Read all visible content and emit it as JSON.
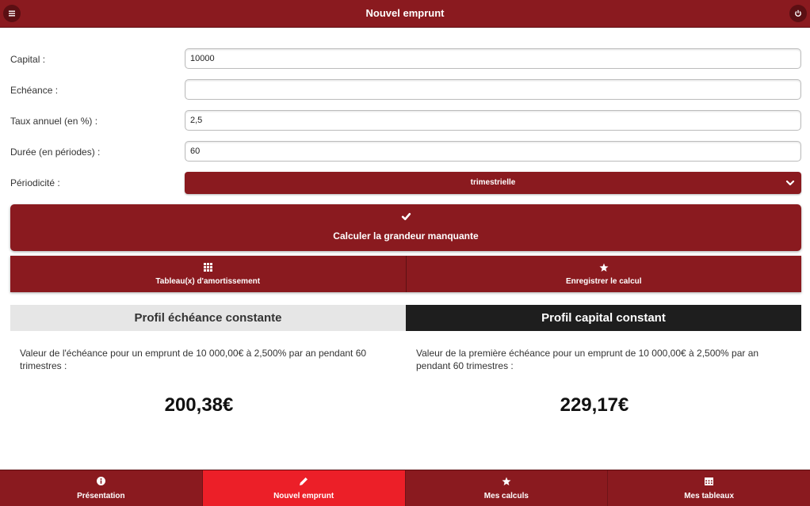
{
  "header": {
    "title": "Nouvel emprunt",
    "menu_icon": "menu-icon",
    "power_icon": "power-icon"
  },
  "form": {
    "capital": {
      "label": "Capital :",
      "value": "10000"
    },
    "echeance": {
      "label": "Echéance :",
      "value": ""
    },
    "taux": {
      "label": "Taux annuel (en %) :",
      "value": "2,5"
    },
    "duree": {
      "label": "Durée (en périodes) :",
      "value": "60"
    },
    "periodicite": {
      "label": "Périodicité :",
      "selected": "trimestrielle"
    }
  },
  "actions": {
    "calculate_label": "Calculer la grandeur manquante",
    "tableaux_label": "Tableau(x) d'amortissement",
    "enregistrer_label": "Enregistrer le calcul"
  },
  "profiles": {
    "constant_payment": {
      "tab_label": "Profil échéance constante",
      "description": "Valeur de l'échéance pour un emprunt de 10 000,00€ à 2,500% par an pendant 60 trimestres :",
      "value": "200,38€"
    },
    "constant_capital": {
      "tab_label": "Profil capital constant",
      "description": "Valeur de la première échéance pour un emprunt de 10 000,00€ à 2,500% par an pendant 60 trimestres :",
      "value": "229,17€"
    }
  },
  "nav": {
    "items": [
      {
        "label": "Présentation",
        "icon": "info-icon"
      },
      {
        "label": "Nouvel emprunt",
        "icon": "pencil-icon",
        "active": true
      },
      {
        "label": "Mes calculs",
        "icon": "star-icon"
      },
      {
        "label": "Mes tableaux",
        "icon": "calendar-icon"
      }
    ]
  },
  "colors": {
    "primary": "#8a1a1f",
    "active_nav": "#ec1f28",
    "dark_tab": "#1e1e1e",
    "light_tab": "#e6e6e6"
  }
}
